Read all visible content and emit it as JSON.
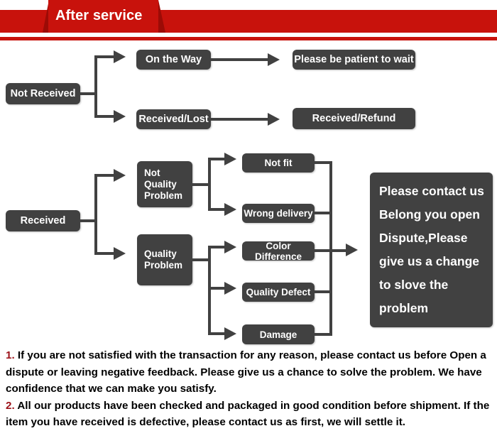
{
  "header": {
    "title": "After service",
    "bar_color": "#c8120c",
    "tab_color": "#9c0b06"
  },
  "flow_top": {
    "source": {
      "label": "Not Received"
    },
    "branches": [
      {
        "stage": "On the Way",
        "result": "Please be patient to wait"
      },
      {
        "stage": "Received/Lost",
        "result": "Received/Refund"
      }
    ]
  },
  "flow_bottom": {
    "source": {
      "label": "Received"
    },
    "categories": [
      {
        "label": "Not\nQuality\nProblem",
        "line1": "Not",
        "line2": "Quality",
        "line3": "Problem",
        "issues": [
          "Not fit",
          "Wrong delivery"
        ]
      },
      {
        "label": "Quality\nProblem",
        "line1": "Quality",
        "line2": "Problem",
        "issues": [
          "Color Difference",
          "Quality Defect",
          "Damage"
        ]
      }
    ],
    "outcome": {
      "lines": [
        "Please contact us",
        "Belong you open",
        "Dispute,Please",
        "give us a change",
        "to slove the",
        "problem"
      ]
    }
  },
  "notes": {
    "item1_number": "1.",
    "item1_text": " If you are not satisfied with the transaction for any reason, please contact us before Open a dispute or leaving negative feedback. Please give us a chance to solve the problem. We have confidence that we can make you satisfy.",
    "item2_number": "2.",
    "item2_text": " All our products have been checked and packaged in good condition before shipment. If the item you have received is defective, please contact us as first, we will settle it."
  },
  "colors": {
    "node_bg": "#414141",
    "accent_red": "#c8120c",
    "dark_red": "#9c0b06",
    "note_number": "#9c1219"
  }
}
